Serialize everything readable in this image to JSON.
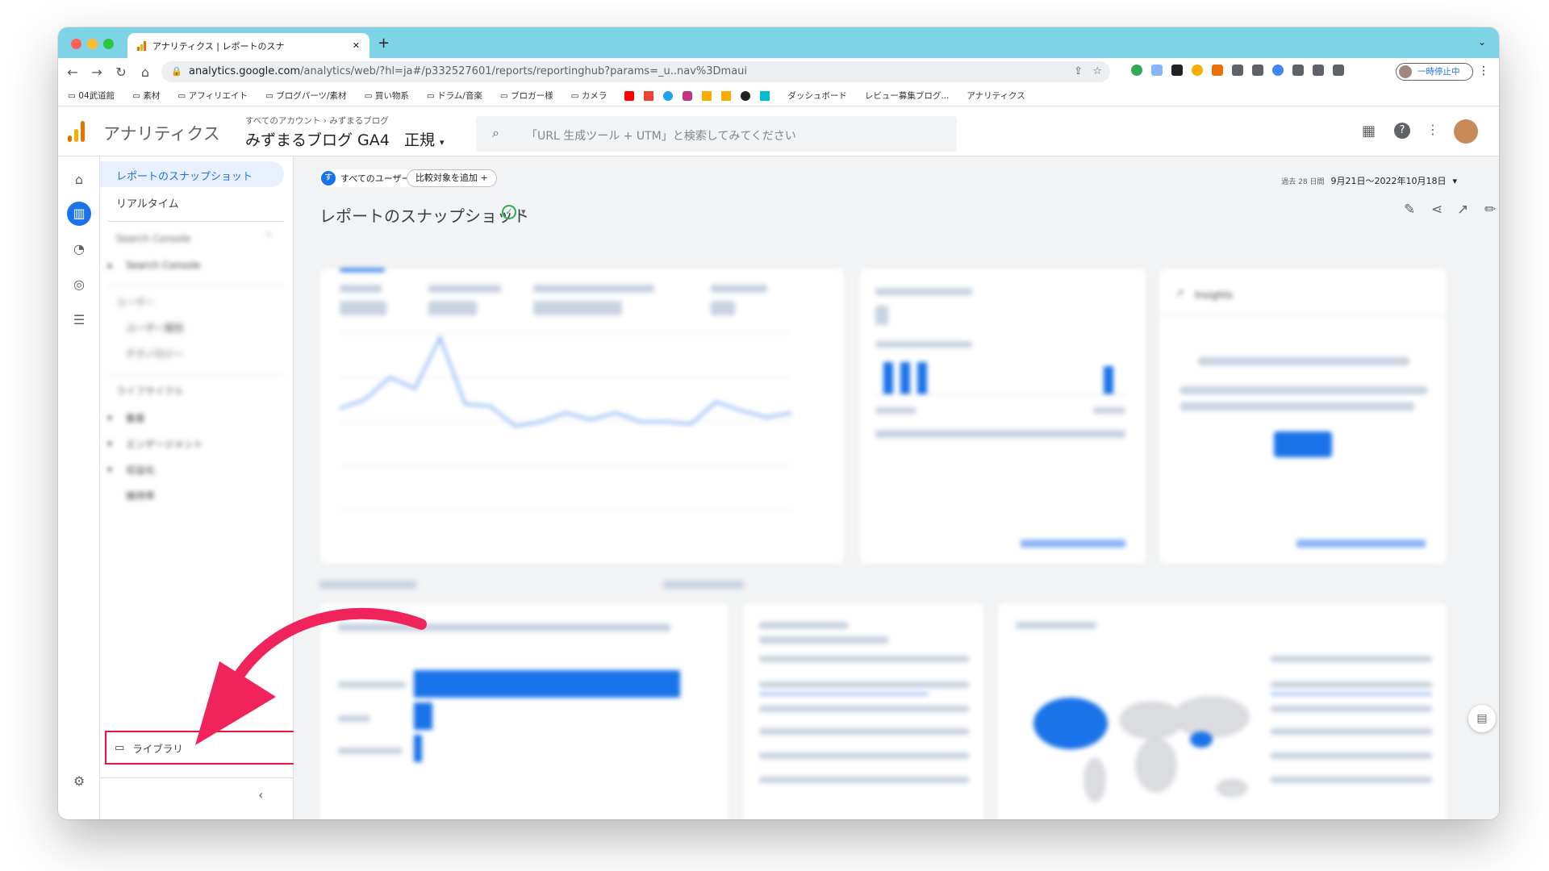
{
  "browser": {
    "tab_title": "アナリティクス | レポートのスナ",
    "url_host": "analytics.google.com",
    "url_path": "/analytics/web/?hl=ja#/p332527601/reports/reportinghub?params=_u..nav%3Dmaui",
    "pause_label": "一時停止中",
    "bookmarks": [
      "04武道館",
      "素材",
      "アフィリエイト",
      "ブログパーツ/素材",
      "買い物系",
      "ドラム/音楽",
      "ブロガー様",
      "カメラ",
      "ダッシュボード",
      "レビュー募集ブログ...",
      "アナリティクス"
    ]
  },
  "app": {
    "name": "アナリティクス",
    "breadcrumb": "すべてのアカウント › みずまるブログ",
    "property": "みずまるブログ GA4",
    "view": "正規",
    "search_placeholder": "「URL 生成ツール + UTM」と検索してみてください"
  },
  "sidebar": {
    "items": [
      {
        "label": "レポートのスナップショット",
        "active": true
      },
      {
        "label": "リアルタイム"
      }
    ],
    "sections": [
      {
        "title": "Search Console",
        "items": [
          "Search Console"
        ]
      },
      {
        "title": "ユーザー",
        "items": [
          "ユーザー属性",
          "テクノロジー"
        ]
      },
      {
        "title": "ライフサイクル",
        "items": [
          "集客",
          "エンゲージメント",
          "収益化",
          "維持率"
        ]
      }
    ],
    "library_label": "ライブラリ"
  },
  "main": {
    "segment": "すべてのユーザー",
    "compare": "比較対象を追加",
    "date_prefix": "過去 28 日間",
    "date_range": "9月21日～2022年10月18日",
    "title": "レポートのスナップショット",
    "insights_title": "Insights",
    "section_new_users": "新規ユーザーの参照元",
    "section_campaign": "上位のキャンペーン"
  },
  "chart_data": [
    {
      "type": "line",
      "series": [
        {
          "values": [
            46,
            50,
            60,
            55,
            78,
            48,
            47,
            38,
            40,
            44,
            41,
            44,
            40,
            40,
            39,
            49,
            45,
            42,
            44
          ]
        }
      ],
      "ylim": [
        0,
        80
      ]
    },
    {
      "type": "bar",
      "values": [
        8,
        8,
        8,
        0,
        0,
        0,
        0,
        0,
        0,
        0,
        0,
        0,
        0,
        7
      ]
    },
    {
      "type": "bar",
      "categories": [
        "Organic Search",
        "Direct",
        "Organic Social"
      ],
      "values": [
        100,
        7,
        3
      ]
    }
  ],
  "colors": {
    "accent": "#1a73e8",
    "arrow": "#f0245a",
    "tabbar": "#7ed4e6",
    "highlight": "#e8173a"
  }
}
